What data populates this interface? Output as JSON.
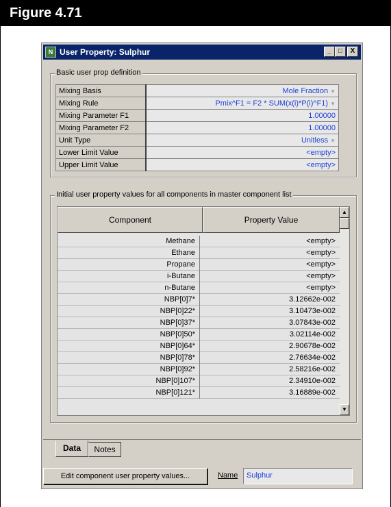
{
  "figure": {
    "label": "Figure 4.71"
  },
  "window": {
    "title": "User Property: Sulphur",
    "controls": {
      "minimize": "_",
      "maximize": "□",
      "close": "X"
    }
  },
  "basic_group": {
    "title": "Basic user prop definition",
    "rows": [
      {
        "label": "Mixing Basis",
        "value": "Mole Fraction",
        "dropdown": true
      },
      {
        "label": "Mixing Rule",
        "value": "Pmix^F1 = F2 * SUM(x(i)*P(i)^F1)",
        "dropdown": true
      },
      {
        "label": "Mixing Parameter F1",
        "value": "1.00000",
        "dropdown": false
      },
      {
        "label": "Mixing Parameter F2",
        "value": "1.00000",
        "dropdown": false
      },
      {
        "label": "Unit Type",
        "value": "Unitless",
        "dropdown": true
      },
      {
        "label": "Lower Limit Value",
        "value": "<empty>",
        "dropdown": false
      },
      {
        "label": "Upper Limit Value",
        "value": "<empty>",
        "dropdown": false
      }
    ]
  },
  "initial_group": {
    "title": "Initial user property values for all components in master component list",
    "columns": [
      "Component",
      "Property Value"
    ],
    "rows": [
      [
        "Methane",
        "<empty>"
      ],
      [
        "Ethane",
        "<empty>"
      ],
      [
        "Propane",
        "<empty>"
      ],
      [
        "i-Butane",
        "<empty>"
      ],
      [
        "n-Butane",
        "<empty>"
      ],
      [
        "NBP[0]7*",
        "3.12662e-002"
      ],
      [
        "NBP[0]22*",
        "3.10473e-002"
      ],
      [
        "NBP[0]37*",
        "3.07843e-002"
      ],
      [
        "NBP[0]50*",
        "3.02114e-002"
      ],
      [
        "NBP[0]64*",
        "2.90678e-002"
      ],
      [
        "NBP[0]78*",
        "2.76634e-002"
      ],
      [
        "NBP[0]92*",
        "2.58216e-002"
      ],
      [
        "NBP[0]107*",
        "2.34910e-002"
      ],
      [
        "NBP[0]121*",
        "3.16889e-002"
      ]
    ]
  },
  "tabs": [
    "Data",
    "Notes"
  ],
  "footer": {
    "edit_button": "Edit component user property values...",
    "name_label": "Name",
    "name_value": "Sulphur"
  },
  "icons": {
    "scroll_up": "▲",
    "scroll_down": "▼",
    "dropdown": "▼"
  }
}
